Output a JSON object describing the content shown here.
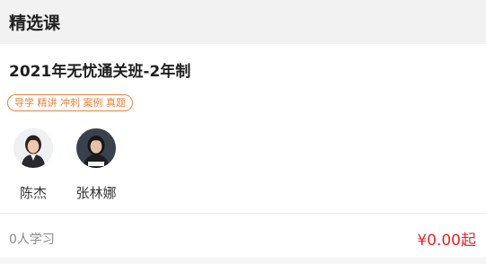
{
  "section": {
    "title": "精选课"
  },
  "course": {
    "title": "2021年无忧通关班-2年制",
    "tag": "导学 精讲 冲刺 案例 真题",
    "teachers": [
      {
        "name": "陈杰",
        "avatar_icon": "teacher-avatar-icon"
      },
      {
        "name": "张林娜",
        "avatar_icon": "teacher-avatar-icon"
      }
    ],
    "learners": "0人学习",
    "price": "¥0.00起"
  },
  "colors": {
    "accent_orange": "#e8823a",
    "price_red": "#e0262b",
    "header_bg": "#f2f2f2"
  }
}
